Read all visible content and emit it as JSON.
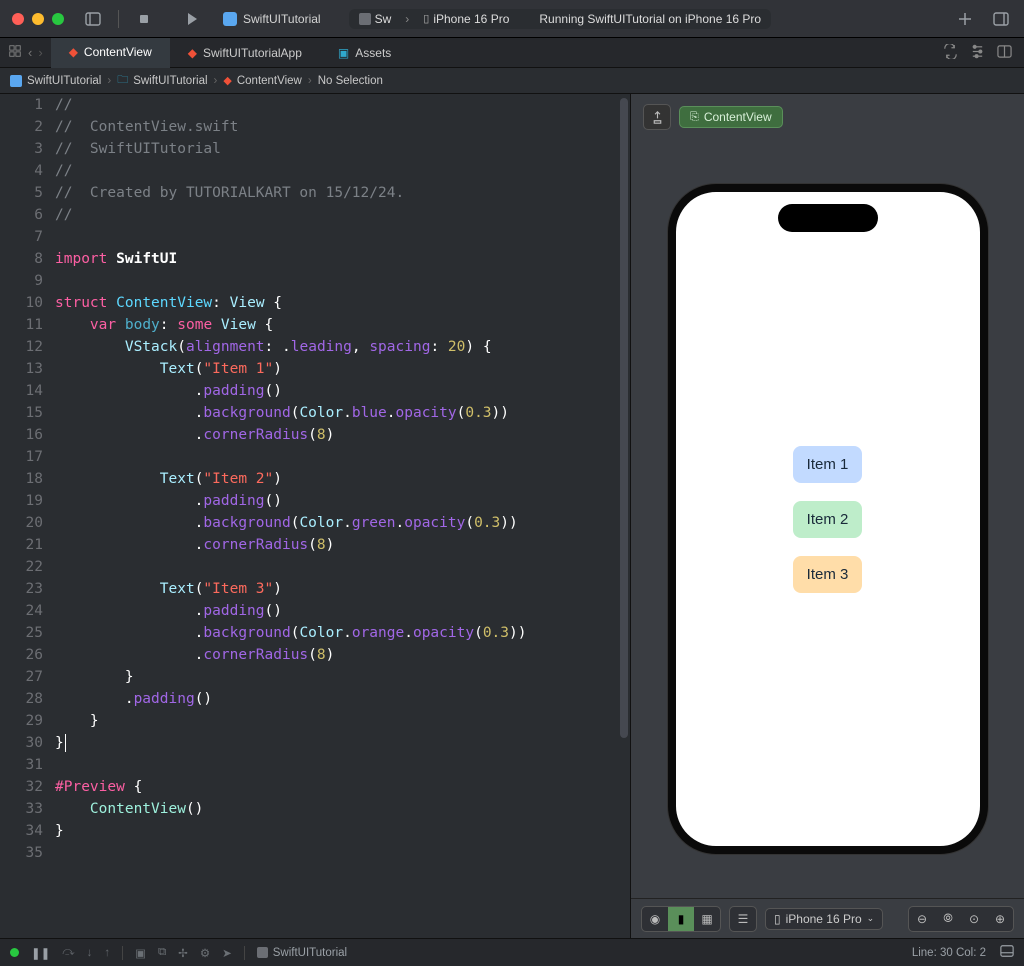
{
  "titlebar": {
    "scheme_app": "SwiftUITutorial",
    "device_short": "Sw",
    "device_full": "iPhone 16 Pro",
    "status": "Running SwiftUITutorial on iPhone 16 Pro"
  },
  "tabs": [
    {
      "label": "ContentView",
      "kind": "swift",
      "active": true
    },
    {
      "label": "SwiftUITutorialApp",
      "kind": "swift",
      "active": false
    },
    {
      "label": "Assets",
      "kind": "assets",
      "active": false
    }
  ],
  "breadcrumb": {
    "project": "SwiftUITutorial",
    "folder": "SwiftUITutorial",
    "file": "ContentView",
    "selection": "No Selection"
  },
  "code": {
    "lines": [
      {
        "n": 1,
        "segments": [
          {
            "t": "//",
            "c": "c-comment"
          }
        ]
      },
      {
        "n": 2,
        "segments": [
          {
            "t": "//  ContentView.swift",
            "c": "c-comment"
          }
        ]
      },
      {
        "n": 3,
        "segments": [
          {
            "t": "//  SwiftUITutorial",
            "c": "c-comment"
          }
        ]
      },
      {
        "n": 4,
        "segments": [
          {
            "t": "//",
            "c": "c-comment"
          }
        ]
      },
      {
        "n": 5,
        "segments": [
          {
            "t": "//  Created by TUTORIALKART on 15/12/24.",
            "c": "c-comment"
          }
        ]
      },
      {
        "n": 6,
        "segments": [
          {
            "t": "//",
            "c": "c-comment"
          }
        ]
      },
      {
        "n": 7,
        "segments": [
          {
            "t": "",
            "c": "c-default"
          }
        ]
      },
      {
        "n": 8,
        "segments": [
          {
            "t": "import",
            "c": "c-keyword"
          },
          {
            "t": " ",
            "c": "c-default"
          },
          {
            "t": "SwiftUI",
            "c": "c-ident"
          }
        ]
      },
      {
        "n": 9,
        "segments": [
          {
            "t": "",
            "c": "c-default"
          }
        ]
      },
      {
        "n": 10,
        "segments": [
          {
            "t": "struct",
            "c": "c-keyword"
          },
          {
            "t": " ",
            "c": "c-default"
          },
          {
            "t": "ContentView",
            "c": "c-typedef"
          },
          {
            "t": ": ",
            "c": "c-default"
          },
          {
            "t": "View",
            "c": "c-mod"
          },
          {
            "t": " {",
            "c": "c-default"
          }
        ]
      },
      {
        "n": 11,
        "segments": [
          {
            "t": "    ",
            "c": "c-default"
          },
          {
            "t": "var",
            "c": "c-keyword"
          },
          {
            "t": " ",
            "c": "c-default"
          },
          {
            "t": "body",
            "c": "c-prop"
          },
          {
            "t": ": ",
            "c": "c-default"
          },
          {
            "t": "some",
            "c": "c-some"
          },
          {
            "t": " ",
            "c": "c-default"
          },
          {
            "t": "View",
            "c": "c-mod"
          },
          {
            "t": " {",
            "c": "c-default"
          }
        ]
      },
      {
        "n": 12,
        "segments": [
          {
            "t": "        ",
            "c": "c-default"
          },
          {
            "t": "VStack",
            "c": "c-mod"
          },
          {
            "t": "(",
            "c": "c-paren"
          },
          {
            "t": "alignment",
            "c": "c-func"
          },
          {
            "t": ": .",
            "c": "c-default"
          },
          {
            "t": "leading",
            "c": "c-func"
          },
          {
            "t": ", ",
            "c": "c-default"
          },
          {
            "t": "spacing",
            "c": "c-func"
          },
          {
            "t": ": ",
            "c": "c-default"
          },
          {
            "t": "20",
            "c": "c-num"
          },
          {
            "t": ") {",
            "c": "c-default"
          }
        ]
      },
      {
        "n": 13,
        "segments": [
          {
            "t": "            ",
            "c": "c-default"
          },
          {
            "t": "Text",
            "c": "c-mod"
          },
          {
            "t": "(",
            "c": "c-paren"
          },
          {
            "t": "\"Item 1\"",
            "c": "c-string"
          },
          {
            "t": ")",
            "c": "c-paren"
          }
        ]
      },
      {
        "n": 14,
        "segments": [
          {
            "t": "                .",
            "c": "c-default"
          },
          {
            "t": "padding",
            "c": "c-func"
          },
          {
            "t": "()",
            "c": "c-paren"
          }
        ]
      },
      {
        "n": 15,
        "segments": [
          {
            "t": "                .",
            "c": "c-default"
          },
          {
            "t": "background",
            "c": "c-func"
          },
          {
            "t": "(",
            "c": "c-paren"
          },
          {
            "t": "Color",
            "c": "c-mod"
          },
          {
            "t": ".",
            "c": "c-default"
          },
          {
            "t": "blue",
            "c": "c-func"
          },
          {
            "t": ".",
            "c": "c-default"
          },
          {
            "t": "opacity",
            "c": "c-func"
          },
          {
            "t": "(",
            "c": "c-paren"
          },
          {
            "t": "0.3",
            "c": "c-num"
          },
          {
            "t": "))",
            "c": "c-paren"
          }
        ]
      },
      {
        "n": 16,
        "segments": [
          {
            "t": "                .",
            "c": "c-default"
          },
          {
            "t": "cornerRadius",
            "c": "c-func"
          },
          {
            "t": "(",
            "c": "c-paren"
          },
          {
            "t": "8",
            "c": "c-num"
          },
          {
            "t": ")",
            "c": "c-paren"
          }
        ]
      },
      {
        "n": 17,
        "segments": [
          {
            "t": "",
            "c": "c-default"
          }
        ]
      },
      {
        "n": 18,
        "segments": [
          {
            "t": "            ",
            "c": "c-default"
          },
          {
            "t": "Text",
            "c": "c-mod"
          },
          {
            "t": "(",
            "c": "c-paren"
          },
          {
            "t": "\"Item 2\"",
            "c": "c-string"
          },
          {
            "t": ")",
            "c": "c-paren"
          }
        ]
      },
      {
        "n": 19,
        "segments": [
          {
            "t": "                .",
            "c": "c-default"
          },
          {
            "t": "padding",
            "c": "c-func"
          },
          {
            "t": "()",
            "c": "c-paren"
          }
        ]
      },
      {
        "n": 20,
        "segments": [
          {
            "t": "                .",
            "c": "c-default"
          },
          {
            "t": "background",
            "c": "c-func"
          },
          {
            "t": "(",
            "c": "c-paren"
          },
          {
            "t": "Color",
            "c": "c-mod"
          },
          {
            "t": ".",
            "c": "c-default"
          },
          {
            "t": "green",
            "c": "c-func"
          },
          {
            "t": ".",
            "c": "c-default"
          },
          {
            "t": "opacity",
            "c": "c-func"
          },
          {
            "t": "(",
            "c": "c-paren"
          },
          {
            "t": "0.3",
            "c": "c-num"
          },
          {
            "t": "))",
            "c": "c-paren"
          }
        ]
      },
      {
        "n": 21,
        "segments": [
          {
            "t": "                .",
            "c": "c-default"
          },
          {
            "t": "cornerRadius",
            "c": "c-func"
          },
          {
            "t": "(",
            "c": "c-paren"
          },
          {
            "t": "8",
            "c": "c-num"
          },
          {
            "t": ")",
            "c": "c-paren"
          }
        ]
      },
      {
        "n": 22,
        "segments": [
          {
            "t": "",
            "c": "c-default"
          }
        ]
      },
      {
        "n": 23,
        "segments": [
          {
            "t": "            ",
            "c": "c-default"
          },
          {
            "t": "Text",
            "c": "c-mod"
          },
          {
            "t": "(",
            "c": "c-paren"
          },
          {
            "t": "\"Item 3\"",
            "c": "c-string"
          },
          {
            "t": ")",
            "c": "c-paren"
          }
        ]
      },
      {
        "n": 24,
        "segments": [
          {
            "t": "                .",
            "c": "c-default"
          },
          {
            "t": "padding",
            "c": "c-func"
          },
          {
            "t": "()",
            "c": "c-paren"
          }
        ]
      },
      {
        "n": 25,
        "segments": [
          {
            "t": "                .",
            "c": "c-default"
          },
          {
            "t": "background",
            "c": "c-func"
          },
          {
            "t": "(",
            "c": "c-paren"
          },
          {
            "t": "Color",
            "c": "c-mod"
          },
          {
            "t": ".",
            "c": "c-default"
          },
          {
            "t": "orange",
            "c": "c-func"
          },
          {
            "t": ".",
            "c": "c-default"
          },
          {
            "t": "opacity",
            "c": "c-func"
          },
          {
            "t": "(",
            "c": "c-paren"
          },
          {
            "t": "0.3",
            "c": "c-num"
          },
          {
            "t": "))",
            "c": "c-paren"
          }
        ]
      },
      {
        "n": 26,
        "segments": [
          {
            "t": "                .",
            "c": "c-default"
          },
          {
            "t": "cornerRadius",
            "c": "c-func"
          },
          {
            "t": "(",
            "c": "c-paren"
          },
          {
            "t": "8",
            "c": "c-num"
          },
          {
            "t": ")",
            "c": "c-paren"
          }
        ]
      },
      {
        "n": 27,
        "segments": [
          {
            "t": "        }",
            "c": "c-default"
          }
        ]
      },
      {
        "n": 28,
        "segments": [
          {
            "t": "        .",
            "c": "c-default"
          },
          {
            "t": "padding",
            "c": "c-func"
          },
          {
            "t": "()",
            "c": "c-paren"
          }
        ]
      },
      {
        "n": 29,
        "segments": [
          {
            "t": "    }",
            "c": "c-default"
          }
        ]
      },
      {
        "n": 30,
        "segments": [
          {
            "t": "}",
            "c": "c-default"
          }
        ],
        "cursor": true
      },
      {
        "n": 31,
        "segments": [
          {
            "t": "",
            "c": "c-default"
          }
        ]
      },
      {
        "n": 32,
        "segments": [
          {
            "t": "#Preview",
            "c": "c-hash"
          },
          {
            "t": " {",
            "c": "c-default"
          }
        ]
      },
      {
        "n": 33,
        "segments": [
          {
            "t": "    ",
            "c": "c-default"
          },
          {
            "t": "ContentView",
            "c": "c-type"
          },
          {
            "t": "()",
            "c": "c-paren"
          }
        ]
      },
      {
        "n": 34,
        "segments": [
          {
            "t": "}",
            "c": "c-default"
          }
        ]
      },
      {
        "n": 35,
        "segments": [
          {
            "t": "",
            "c": "c-default"
          }
        ]
      }
    ]
  },
  "preview": {
    "badge": "ContentView",
    "items": [
      {
        "text": "Item 1",
        "cls": "it-blue"
      },
      {
        "text": "Item 2",
        "cls": "it-green"
      },
      {
        "text": "Item 3",
        "cls": "it-orange"
      }
    ],
    "device_select": "iPhone 16 Pro"
  },
  "statusbar": {
    "scheme": "SwiftUITutorial",
    "cursor": "Line: 30  Col: 2"
  }
}
